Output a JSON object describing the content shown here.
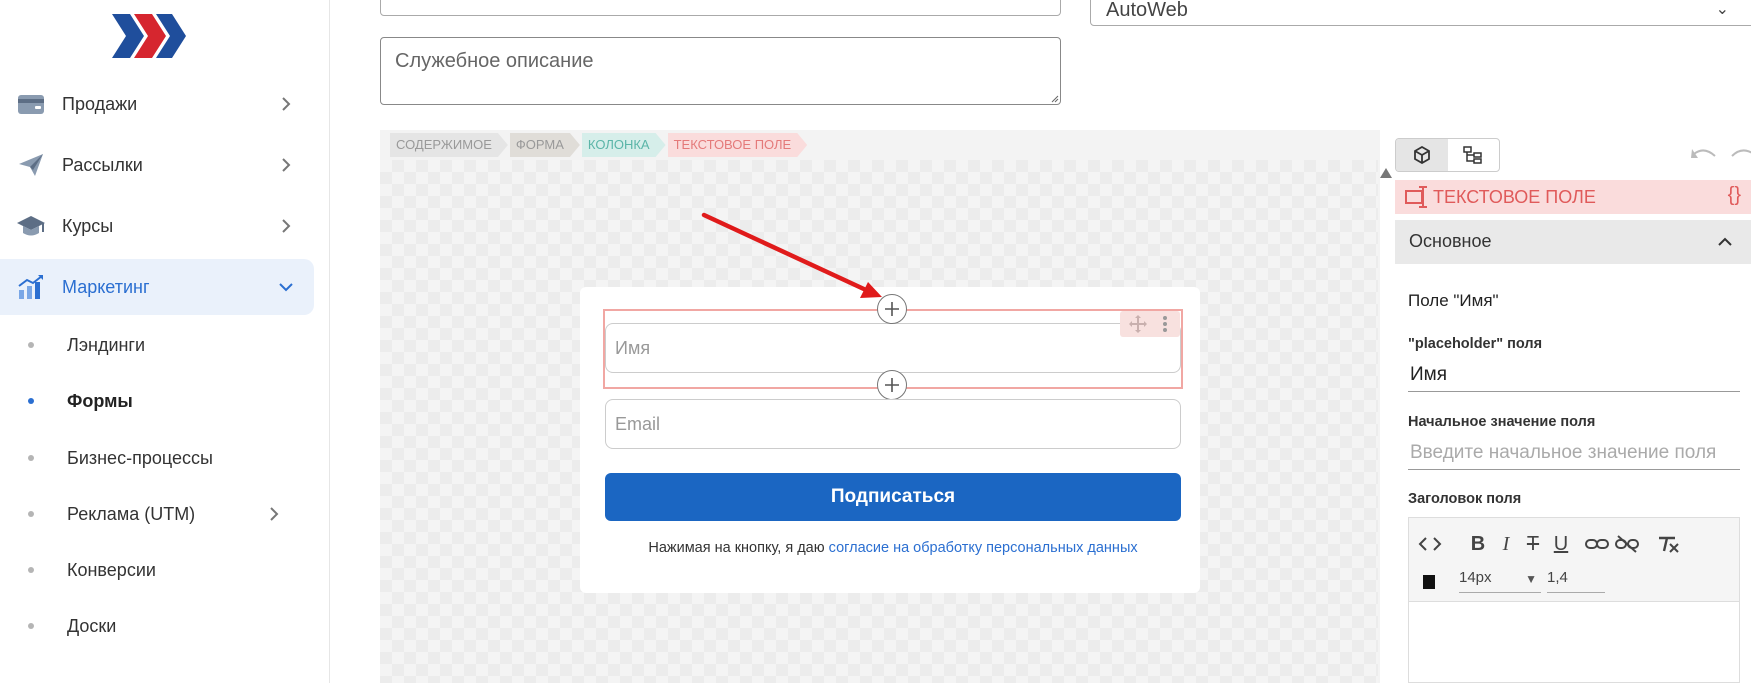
{
  "sidebar": {
    "items": [
      {
        "label": "Продажи"
      },
      {
        "label": "Рассылки"
      },
      {
        "label": "Курсы"
      },
      {
        "label": "Маркетинг"
      }
    ],
    "subitems": [
      {
        "label": "Лэндинги"
      },
      {
        "label": "Формы"
      },
      {
        "label": "Бизнес-процессы"
      },
      {
        "label": "Реклама (UTM)"
      },
      {
        "label": "Конверсии"
      },
      {
        "label": "Доски"
      }
    ]
  },
  "form": {
    "select_value": "AutoWeb",
    "description_placeholder": "Служебное описание"
  },
  "breadcrumbs": [
    "СОДЕРЖИМОЕ",
    "ФОРМА",
    "КОЛОНКА",
    "ТЕКСТОВОЕ ПОЛЕ"
  ],
  "canvas": {
    "name_placeholder": "Имя",
    "email_placeholder": "Email",
    "submit_label": "Подписаться",
    "consent_text": "Нажимая на кнопку, я даю ",
    "consent_link": "согласие на обработку персональных данных"
  },
  "panel": {
    "element_title": "ТЕКСТОВОЕ ПОЛЕ",
    "code_label": "{}",
    "section_label": "Основное",
    "field_title": "Поле \"Имя\"",
    "placeholder_label": "\"placeholder\" поля",
    "placeholder_value": "Имя",
    "initial_label": "Начальное значение поля",
    "initial_placeholder": "Введите начальное значение поля",
    "heading_label": "Заголовок поля",
    "font_size": "14px",
    "line_height": "1,4"
  },
  "colors": {
    "accent": "#2b6fd1",
    "submit": "#1b66c2",
    "selected_outline": "#f1a7a3",
    "element_header": "#fadcdc"
  }
}
